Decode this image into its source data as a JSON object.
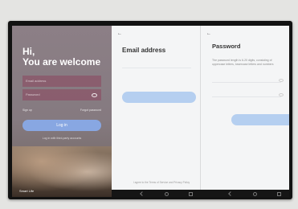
{
  "welcome": {
    "greeting": "Hi,",
    "message": "You are welcome",
    "email_placeholder": "Email address",
    "password_placeholder": "Password",
    "sign_up": "Sign up",
    "forgot_password": "Forgot password",
    "login_label": "Log in",
    "social_text": "Log in with third-party accounts",
    "brand": "Smart Life"
  },
  "email_screen": {
    "title": "Email address",
    "terms": "I agree to the Terms of Service and Privacy Policy"
  },
  "password_screen": {
    "title": "Password",
    "hint": "The password length is 6-20 digits, consisting of uppercase letters, lowercase letters and numbers"
  },
  "colors": {
    "accent": "#88aae8",
    "accent_light": "#b5cff0",
    "field_bg": "#8c465f",
    "nav_bar": "#151515"
  }
}
